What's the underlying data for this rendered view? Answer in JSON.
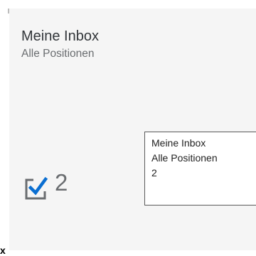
{
  "tile": {
    "title": "Meine Inbox",
    "subtitle": "Alle Positionen",
    "count": "2",
    "icon": "task-checkbox-icon",
    "accent_color": "#0a6ed1"
  },
  "tooltip": {
    "line1": "Meine Inbox",
    "line2": "Alle Positionen",
    "line3": "2"
  },
  "fragment": {
    "text": "x"
  }
}
